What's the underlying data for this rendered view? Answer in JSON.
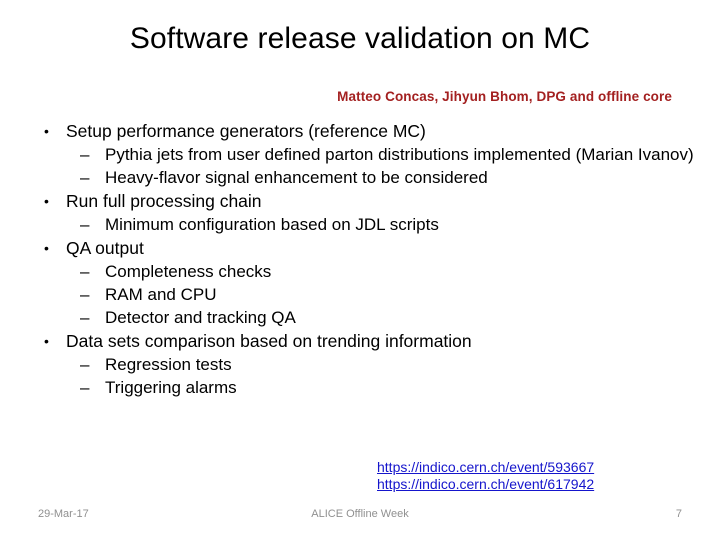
{
  "slide": {
    "title": "Software release validation on MC",
    "subtitle": "Matteo Concas, Jihyun Bhom, DPG and offline core",
    "colors": {
      "title": "#000000",
      "subtitle": "#A32020",
      "link": "#1515CC",
      "footer": "#909090",
      "background": "#ffffff"
    },
    "bullets": [
      {
        "level": 1,
        "marker": "•",
        "text": "Setup performance generators (reference MC)"
      },
      {
        "level": 2,
        "marker": "–",
        "text": "Pythia jets from user defined parton distributions implemented (Marian Ivanov)"
      },
      {
        "level": 2,
        "marker": "–",
        "text": "Heavy-flavor signal enhancement to be considered"
      },
      {
        "level": 1,
        "marker": "•",
        "text": "Run full processing chain"
      },
      {
        "level": 2,
        "marker": "–",
        "text": "Minimum configuration based on JDL scripts"
      },
      {
        "level": 1,
        "marker": "•",
        "text": "QA output"
      },
      {
        "level": 2,
        "marker": "–",
        "text": "Completeness checks"
      },
      {
        "level": 2,
        "marker": "–",
        "text": "RAM and CPU"
      },
      {
        "level": 2,
        "marker": "–",
        "text": "Detector and tracking QA"
      },
      {
        "level": 1,
        "marker": "•",
        "text": "Data sets comparison based on trending information"
      },
      {
        "level": 2,
        "marker": "–",
        "text": "Regression tests"
      },
      {
        "level": 2,
        "marker": "–",
        "text": "Triggering alarms"
      }
    ],
    "links": [
      "https://indico.cern.ch/event/593667",
      "https://indico.cern.ch/event/617942"
    ],
    "footer": {
      "date": "29-Mar-17",
      "center": "ALICE Offline Week",
      "page": "7"
    }
  }
}
